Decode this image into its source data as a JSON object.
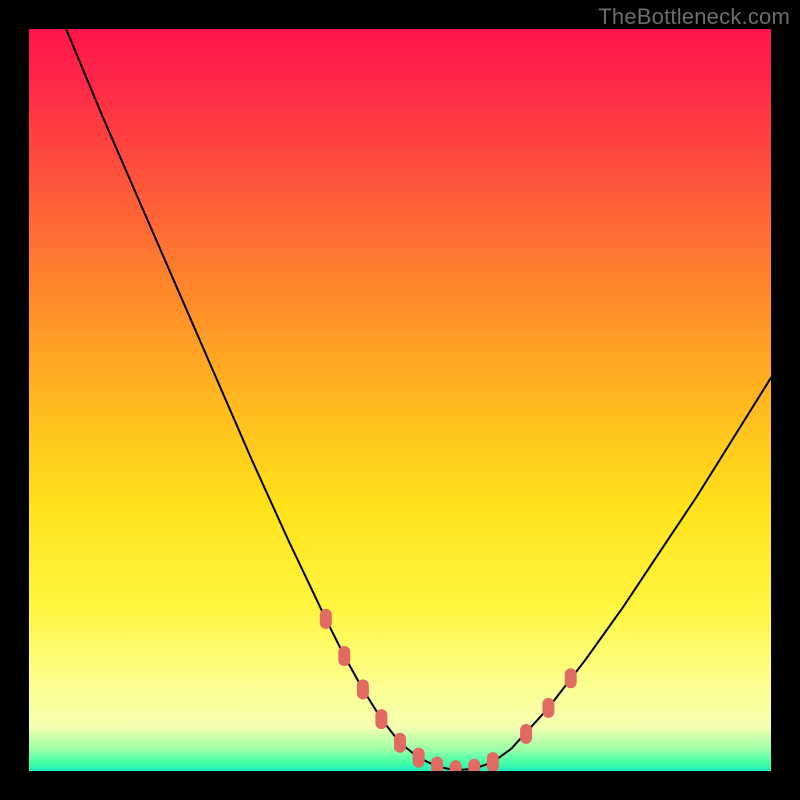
{
  "watermark": "TheBottleneck.com",
  "chart_data": {
    "type": "line",
    "title": "",
    "xlabel": "",
    "ylabel": "",
    "xlim": [
      0,
      100
    ],
    "ylim": [
      0,
      100
    ],
    "grid": false,
    "legend": false,
    "background": "red-yellow-green-vertical-gradient",
    "series": [
      {
        "name": "bottleneck-curve",
        "x": [
          5,
          10,
          15,
          20,
          25,
          30,
          35,
          40,
          42.5,
          45,
          47.5,
          50,
          52.5,
          55,
          57.5,
          60,
          62.5,
          65,
          70,
          75,
          80,
          85,
          90,
          95,
          100
        ],
        "y": [
          100,
          88,
          76.5,
          65,
          53.5,
          42,
          31,
          20.5,
          15.5,
          11,
          7,
          3.8,
          1.8,
          0.6,
          0.1,
          0.3,
          1.2,
          3,
          8.5,
          15,
          22,
          29.5,
          37,
          45,
          53
        ]
      }
    ],
    "markers": [
      {
        "name": "highlight-dots-left",
        "x": [
          40,
          42.5,
          45,
          47.5,
          50,
          52.5,
          55,
          57.5,
          60,
          62.5
        ],
        "y": [
          20.5,
          15.5,
          11,
          7,
          3.8,
          1.8,
          0.6,
          0.1,
          0.3,
          1.2
        ]
      },
      {
        "name": "highlight-dots-right",
        "x": [
          67,
          70,
          73
        ],
        "y": [
          5,
          8.5,
          12.5
        ]
      }
    ],
    "colors": {
      "curve": "#000000",
      "dots": "#e16a62",
      "gradient_top": "#ff154d",
      "gradient_mid": "#ffe11a",
      "gradient_bottom": "#20e8c0"
    }
  }
}
